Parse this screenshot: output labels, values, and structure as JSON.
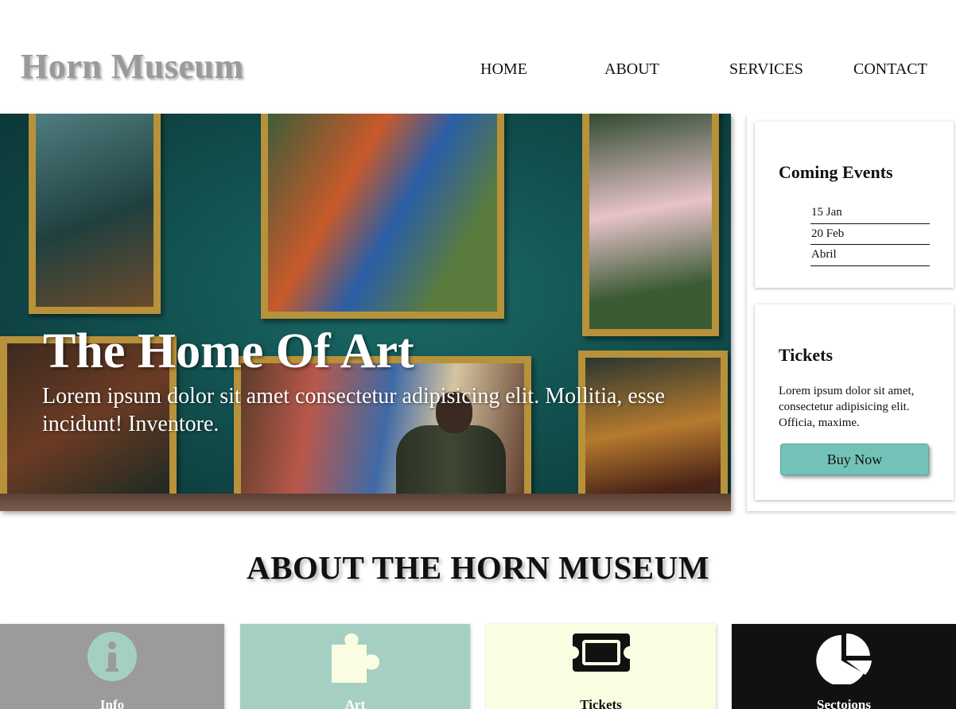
{
  "header": {
    "logo": "Horn Museum",
    "nav": [
      "HOME",
      "ABOUT",
      "SERVICES",
      "CONTACT"
    ]
  },
  "hero": {
    "title": "The Home Of Art",
    "text": "Lorem ipsum dolor sit amet consectetur adipisicing elit. Mollitia, esse incidunt! Inventore."
  },
  "sidebar": {
    "events": {
      "title": "Coming Events",
      "items": [
        "15 Jan",
        "20 Feb",
        "Abril"
      ]
    },
    "tickets": {
      "title": "Tickets",
      "text": "Lorem ipsum dolor sit amet, consectetur adipisicing elit. Officia, maxime.",
      "button": "Buy Now"
    }
  },
  "about": {
    "heading": "ABOUT THE HORN MUSEUM",
    "features": [
      {
        "label": "Info",
        "icon": "info-icon",
        "color": "#9b9b9b"
      },
      {
        "label": "Art",
        "icon": "puzzle-icon",
        "color": "#a6cfc3"
      },
      {
        "label": "Tickets",
        "icon": "ticket-icon",
        "color": "#fbfde3"
      },
      {
        "label": "Sectoions",
        "icon": "pie-chart-icon",
        "color": "#111111"
      }
    ]
  },
  "colors": {
    "accent": "#72c2b7",
    "logo": "#9a9a9a"
  }
}
